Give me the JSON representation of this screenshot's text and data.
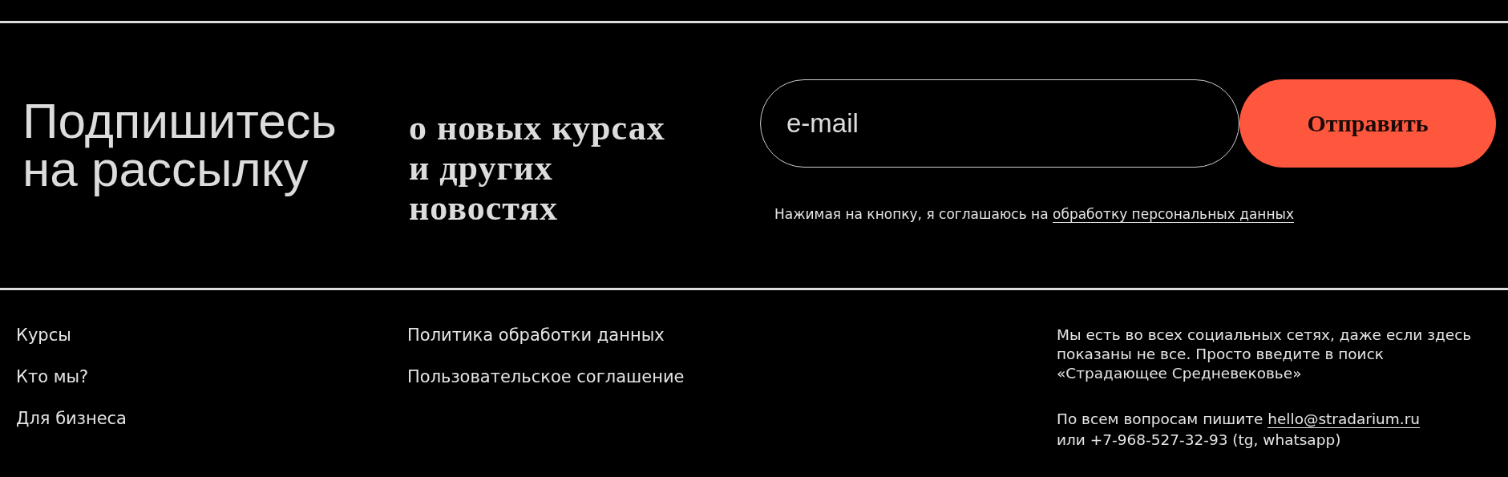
{
  "subscribe": {
    "heading": [
      "Подпишитесь",
      "на рассылку"
    ],
    "tagline": [
      "о новых курсах",
      "и других",
      "новостях"
    ],
    "email_field": {
      "placeholder": "e-mail"
    },
    "submit_button": "Отправить",
    "consent": {
      "text": "Нажимая на кнопку, я соглашаюсь на ",
      "link": "обработку персональных данных"
    }
  },
  "footer": {
    "nav_links": [
      "Курсы",
      "Кто мы?",
      "Для бизнеса"
    ],
    "legal_links": [
      "Политика обработки данных",
      "Пользовательское соглашение"
    ],
    "social_note": "Мы есть во всех социальных сетях, даже если здесь показаны не все. Просто введите в поиск «Страдающее Средневековье»",
    "contact": {
      "prefix": "По всем вопросам пишите ",
      "email": "hello@stradarium.ru",
      "suffix": "или +7-968-527-32-93 (tg, whatsapp)"
    }
  }
}
